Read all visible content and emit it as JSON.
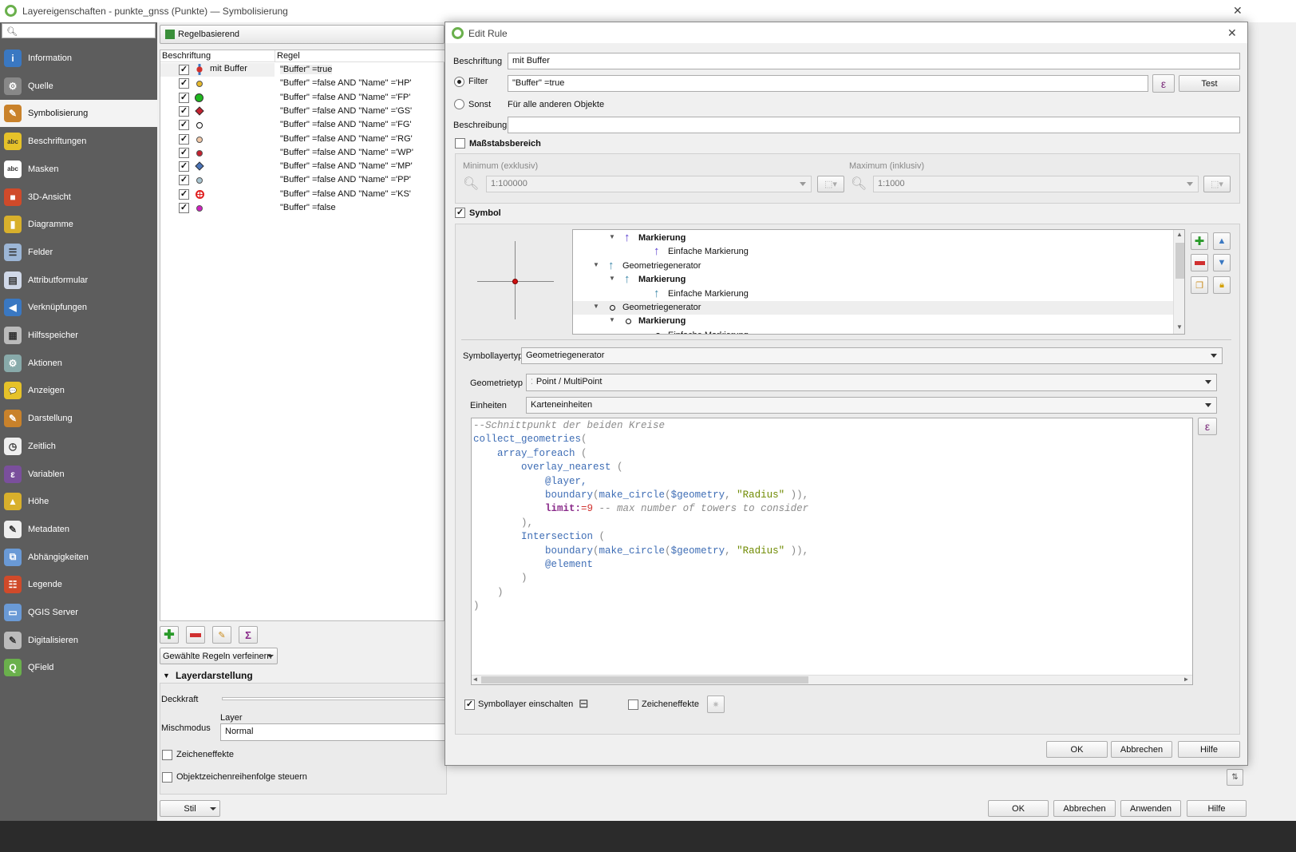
{
  "window": {
    "title": "Layereigenschaften - punkte_gnss (Punkte) — Symbolisierung",
    "close": "✕"
  },
  "sidebar": {
    "search_placeholder": "",
    "items": [
      {
        "label": "Information",
        "icon": "info-icon",
        "color": "#3a78c2",
        "glyph": "i"
      },
      {
        "label": "Quelle",
        "icon": "source-icon",
        "color": "#888",
        "glyph": "⚙"
      },
      {
        "label": "Symbolisierung",
        "icon": "paintbrush-icon",
        "color": "#c9822b",
        "glyph": "✎"
      },
      {
        "label": "Beschriftungen",
        "icon": "labels-abc-icon",
        "color": "#e6c229",
        "glyph": "abc"
      },
      {
        "label": "Masken",
        "icon": "masks-abc-icon",
        "color": "#fff",
        "glyph": "abc"
      },
      {
        "label": "3D-Ansicht",
        "icon": "cube-icon",
        "color": "#d04a2a",
        "glyph": "■"
      },
      {
        "label": "Diagramme",
        "icon": "diagram-icon",
        "color": "#d8b02c",
        "glyph": "▮"
      },
      {
        "label": "Felder",
        "icon": "fields-icon",
        "color": "#9cb6d6",
        "glyph": "☰"
      },
      {
        "label": "Attributformular",
        "icon": "form-icon",
        "color": "#d0d8e8",
        "glyph": "▤"
      },
      {
        "label": "Verknüpfungen",
        "icon": "joins-icon",
        "color": "#3a78c2",
        "glyph": "◀"
      },
      {
        "label": "Hilfsspeicher",
        "icon": "storage-icon",
        "color": "#bbb",
        "glyph": "▦"
      },
      {
        "label": "Aktionen",
        "icon": "actions-gear-icon",
        "color": "#8aa",
        "glyph": "⚙"
      },
      {
        "label": "Anzeigen",
        "icon": "display-bubble-icon",
        "color": "#e6c229",
        "glyph": "💬"
      },
      {
        "label": "Darstellung",
        "icon": "rendering-brush-icon",
        "color": "#c9822b",
        "glyph": "✎"
      },
      {
        "label": "Zeitlich",
        "icon": "clock-icon",
        "color": "#eee",
        "glyph": "◷"
      },
      {
        "label": "Variablen",
        "icon": "variables-epsilon-icon",
        "color": "#7a4f9c",
        "glyph": "ε"
      },
      {
        "label": "Höhe",
        "icon": "elevation-icon",
        "color": "#d8b02c",
        "glyph": "▲"
      },
      {
        "label": "Metadaten",
        "icon": "metadata-icon",
        "color": "#eee",
        "glyph": "✎"
      },
      {
        "label": "Abhängigkeiten",
        "icon": "dependencies-icon",
        "color": "#6a9ad6",
        "glyph": "⧉"
      },
      {
        "label": "Legende",
        "icon": "legend-icon",
        "color": "#d04a2a",
        "glyph": "☷"
      },
      {
        "label": "QGIS Server",
        "icon": "server-icon",
        "color": "#6a9ad6",
        "glyph": "▭"
      },
      {
        "label": "Digitalisieren",
        "icon": "digitize-icon",
        "color": "#bbb",
        "glyph": "✎"
      },
      {
        "label": "QField",
        "icon": "qfield-icon",
        "color": "#6ab04c",
        "glyph": "Q"
      }
    ],
    "selected": "Symbolisierung"
  },
  "renderer": {
    "value": "Regelbasierend"
  },
  "rules": {
    "headers": [
      "Beschriftung",
      "Regel"
    ],
    "rows": [
      {
        "label": "mit Buffer",
        "rule": "\"Buffer\" =true",
        "symbol": "buffer-cross",
        "color": "#d0312d"
      },
      {
        "label": "",
        "rule": "\"Buffer\" =false AND  \"Name\" ='HP'",
        "symbol": "circle",
        "color": "#e6b82a"
      },
      {
        "label": "",
        "rule": "\"Buffer\" =false AND  \"Name\" ='FP'",
        "symbol": "circle-large",
        "color": "#1fb81f"
      },
      {
        "label": "",
        "rule": "\"Buffer\" =false AND  \"Name\" ='GS'",
        "symbol": "diamond",
        "color": "#c4212f"
      },
      {
        "label": "",
        "rule": "\"Buffer\" =false AND  \"Name\" ='FG'",
        "symbol": "circle-hollow",
        "color": "#ffffff"
      },
      {
        "label": "",
        "rule": "\"Buffer\" =false AND  \"Name\" ='RG'",
        "symbol": "circle",
        "color": "#f0c8a8"
      },
      {
        "label": "",
        "rule": "\"Buffer\" =false AND  \"Name\" ='WP'",
        "symbol": "circle",
        "color": "#c4212f"
      },
      {
        "label": "",
        "rule": "\"Buffer\" =false AND  \"Name\" ='MP'",
        "symbol": "diamond",
        "color": "#4a74b8"
      },
      {
        "label": "",
        "rule": "\"Buffer\" =false AND  \"Name\" ='PP'",
        "symbol": "circle",
        "color": "#a8c4d0"
      },
      {
        "label": "",
        "rule": "\"Buffer\" =false AND  \"Name\" ='KS'",
        "symbol": "cross-circle",
        "color": "#e02020"
      },
      {
        "label": "",
        "rule": "\"Buffer\" =false",
        "symbol": "circle",
        "color": "#d020c0"
      }
    ]
  },
  "rule_buttons": {
    "refine": "Gewählte Regeln verfeinern",
    "sigma": "Σ"
  },
  "layer_rendering": {
    "title": "Layerdarstellung",
    "opacity_label": "Deckkraft",
    "blend_label": "Mischmodus",
    "blend_sub": "Layer",
    "blend_value": "Normal",
    "effects": "Zeicheneffekte",
    "order": "Objektzeichenreihenfolge steuern"
  },
  "footer": {
    "style": "Stil",
    "ok": "OK",
    "cancel": "Abbrechen",
    "apply": "Anwenden",
    "help": "Hilfe"
  },
  "dialog": {
    "title": "Edit Rule",
    "close": "✕",
    "label_label": "Beschriftung",
    "label_value": "mit Buffer",
    "filter_label": "Filter",
    "filter_value": "\"Buffer\" =true",
    "epsilon": "ε",
    "test": "Test",
    "else_label": "Sonst",
    "else_text": "Für alle anderen Objekte",
    "desc_label": "Beschreibung",
    "desc_value": "",
    "scale": {
      "title": "Maßstabsbereich",
      "checked": false,
      "min_label": "Minimum (exklusiv)",
      "min_value": "1:100000",
      "max_label": "Maximum (inklusiv)",
      "max_value": "1:1000"
    },
    "symbol": {
      "title": "Symbol",
      "checked": true,
      "tree": [
        {
          "label": "Markierung",
          "bold": true,
          "indent": 2,
          "icon": "arrow-purple"
        },
        {
          "label": "Einfache Markierung",
          "bold": false,
          "indent": 3,
          "icon": "arrow-purple"
        },
        {
          "label": "Geometriegenerator",
          "bold": false,
          "indent": 1,
          "icon": "arrow-teal"
        },
        {
          "label": "Markierung",
          "bold": true,
          "indent": 2,
          "icon": "arrow-teal"
        },
        {
          "label": "Einfache Markierung",
          "bold": false,
          "indent": 3,
          "icon": "arrow-teal"
        },
        {
          "label": "Geometriegenerator",
          "bold": false,
          "indent": 1,
          "icon": "circle",
          "selected": true
        },
        {
          "label": "Markierung",
          "bold": true,
          "indent": 2,
          "icon": "circle"
        },
        {
          "label": "Einfache Markierung",
          "bold": false,
          "indent": 3,
          "icon": "circle"
        }
      ],
      "layer_type_label": "Symbollayertyp",
      "layer_type": "Geometriegenerator",
      "geom_type_label": "Geometrietyp",
      "geom_type": "Point / MultiPoint",
      "units_label": "Einheiten",
      "units": "Karteneinheiten",
      "code": [
        [
          [
            "--Schnittpunkt der beiden Kreise",
            "cm"
          ]
        ],
        [
          [
            "collect_geometries",
            "fn"
          ],
          [
            "(",
            "p"
          ]
        ],
        [
          [
            "    "
          ],
          [
            "array_foreach",
            "fn"
          ],
          [
            " (",
            "p"
          ]
        ],
        [
          [
            "        "
          ],
          [
            "overlay_nearest",
            "fn"
          ],
          [
            " (",
            "p"
          ]
        ],
        [
          [
            "            "
          ],
          [
            "@layer,",
            "v"
          ]
        ],
        [
          [
            "            "
          ],
          [
            "boundary",
            "fn"
          ],
          [
            "(",
            "p"
          ],
          [
            "make_circle",
            "fn"
          ],
          [
            "(",
            "p"
          ],
          [
            "$geometry",
            "fn"
          ],
          [
            ", ",
            "p"
          ],
          [
            "\"Radius\"",
            "str"
          ],
          [
            " ))",
            "p"
          ],
          [
            ",",
            "p"
          ]
        ],
        [
          [
            "            "
          ],
          [
            "limit:",
            "kw"
          ],
          [
            "=9",
            "num"
          ],
          [
            " -- max number of towers to consider",
            "cm"
          ]
        ],
        [
          [
            "        "
          ],
          [
            "),",
            "p"
          ]
        ],
        [
          [
            "        "
          ],
          [
            "Intersection",
            "fn"
          ],
          [
            " (",
            "p"
          ]
        ],
        [
          [
            "            "
          ],
          [
            "boundary",
            "fn"
          ],
          [
            "(",
            "p"
          ],
          [
            "make_circle",
            "fn"
          ],
          [
            "(",
            "p"
          ],
          [
            "$geometry",
            "fn"
          ],
          [
            ", ",
            "p"
          ],
          [
            "\"Radius\"",
            "str"
          ],
          [
            " ))",
            "p"
          ],
          [
            ",",
            "p"
          ]
        ],
        [
          [
            "            "
          ],
          [
            "@element",
            "v"
          ]
        ],
        [
          [
            "        "
          ],
          [
            ")",
            "p"
          ]
        ],
        [
          [
            "    "
          ],
          [
            ")",
            "p"
          ]
        ],
        [
          [
            ")",
            "p"
          ]
        ]
      ],
      "enable_label": "Symbollayer einschalten",
      "enable_checked": true,
      "effects_label": "Zeicheneffekte",
      "effects_checked": false
    },
    "ok": "OK",
    "cancel": "Abbrechen",
    "help": "Hilfe"
  }
}
